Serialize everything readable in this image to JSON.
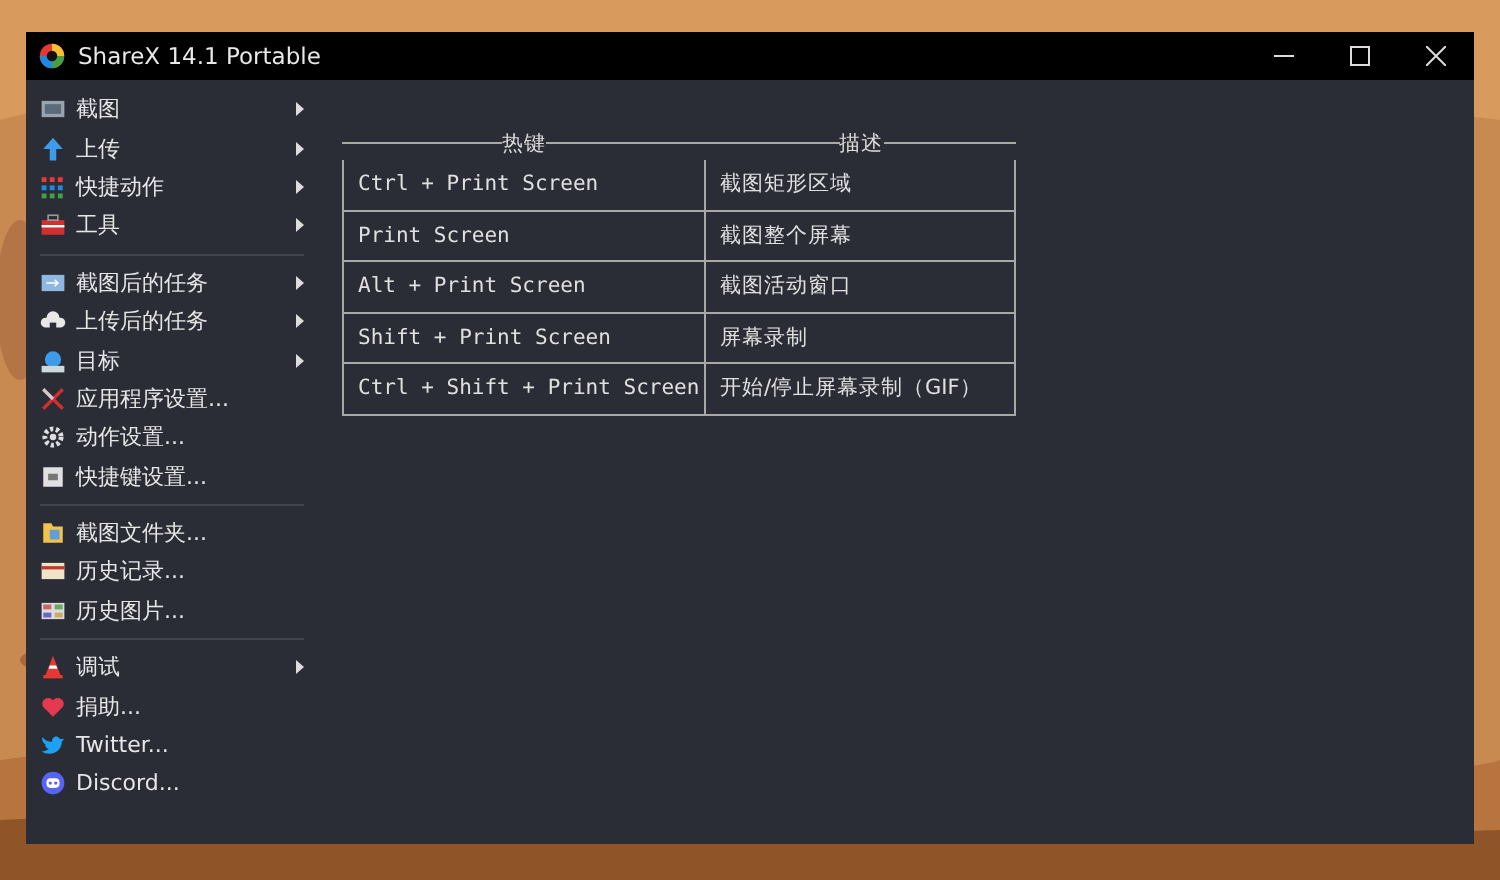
{
  "window": {
    "title": "ShareX 14.1 Portable"
  },
  "menu": [
    [
      {
        "label": "截图",
        "submenu": true
      },
      {
        "label": "上传",
        "submenu": true
      },
      {
        "label": "快捷动作",
        "submenu": true
      },
      {
        "label": "工具",
        "submenu": true
      }
    ],
    [
      {
        "label": "截图后的任务",
        "submenu": true
      },
      {
        "label": "上传后的任务",
        "submenu": true
      },
      {
        "label": "目标",
        "submenu": true
      },
      {
        "label": "应用程序设置...",
        "submenu": false
      },
      {
        "label": "动作设置...",
        "submenu": false
      },
      {
        "label": "快捷键设置...",
        "submenu": false
      }
    ],
    [
      {
        "label": "截图文件夹...",
        "submenu": false
      },
      {
        "label": "历史记录...",
        "submenu": false
      },
      {
        "label": "历史图片...",
        "submenu": false
      }
    ],
    [
      {
        "label": "调试",
        "submenu": true
      },
      {
        "label": "捐助...",
        "submenu": false
      },
      {
        "label": "Twitter...",
        "submenu": false
      },
      {
        "label": "Discord...",
        "submenu": false
      }
    ]
  ],
  "hotkeys": {
    "columns": [
      "热键",
      "描述"
    ],
    "rows": [
      [
        "Ctrl + Print Screen",
        "截图矩形区域"
      ],
      [
        "Print Screen",
        "截图整个屏幕"
      ],
      [
        "Alt + Print Screen",
        "截图活动窗口"
      ],
      [
        "Shift + Print Screen",
        "屏幕录制"
      ],
      [
        "Ctrl + Shift + Print Screen",
        "开始/停止屏幕录制（GIF）"
      ]
    ]
  }
}
